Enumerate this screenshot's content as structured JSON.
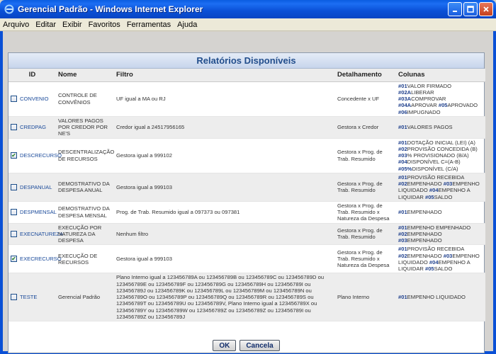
{
  "window": {
    "title": "Gerencial Padrão - Windows Internet Explorer"
  },
  "menu": [
    "Arquivo",
    "Editar",
    "Exibir",
    "Favoritos",
    "Ferramentas",
    "Ajuda"
  ],
  "panel": {
    "title": "Relatórios Disponíveis",
    "headers": {
      "id": "ID",
      "nome": "Nome",
      "filtro": "Filtro",
      "detalhamento": "Detalhamento",
      "colunas": "Colunas"
    },
    "ok_label": "OK",
    "cancel_label": "Cancela"
  },
  "rows": [
    {
      "id": "CONVENIO",
      "checked": false,
      "nome": "CONTROLE DE CONVÊNIOS",
      "filtro": "UF igual a MA ou RJ",
      "detalhamento": "Concedente x UF",
      "colunas": [
        [
          "#01",
          "VALOR FIRMADO "
        ],
        [
          "#02A",
          "LIBERAR "
        ],
        [
          "#03A",
          "COMPROVAR "
        ],
        [
          "#04A",
          "APROVAR "
        ],
        [
          "#05",
          "APROVADO "
        ],
        [
          "#06",
          "IMPUGNADO"
        ]
      ]
    },
    {
      "id": "CREDPAG",
      "checked": false,
      "nome": "VALORES PAGOS POR CREDOR POR NE'S",
      "filtro": "Credor igual a 24517956165",
      "detalhamento": "Gestora x Credor",
      "colunas": [
        [
          "#01",
          "VALORES PAGOS"
        ]
      ]
    },
    {
      "id": "DESCRECURSO",
      "checked": true,
      "nome": "DESCENTRALIZAÇÃO DE RECURSOS",
      "filtro": "Gestora igual a 999102",
      "detalhamento": "Gestora x Prog. de Trab. Resumido",
      "colunas": [
        [
          "#01",
          "DOTAÇÃO INICIAL (LEI) (A) "
        ],
        [
          "#02",
          "PROVISÃO CONCEDIDA (B) "
        ],
        [
          "#03",
          "% PROVISIONADO (B/A) "
        ],
        [
          "#04",
          "DISPONÍVEL C=(A-B) "
        ],
        [
          "#05%",
          "DISPONÍVEL (C/A)"
        ]
      ]
    },
    {
      "id": "DESPANUAL",
      "checked": false,
      "nome": "DEMOSTRATIVO DA DESPESA ANUAL",
      "filtro": "Gestora igual a 999103",
      "detalhamento": "Gestora x Prog. de Trab. Resumido",
      "colunas": [
        [
          "#01",
          "PROVISÃO RECEBIDA "
        ],
        [
          "#02",
          "EMPENHADO "
        ],
        [
          "#03",
          "EMPENHO LIQUIDADO "
        ],
        [
          "#04",
          "EMPENHO A LIQUIDAR "
        ],
        [
          "#05",
          "SALDO"
        ]
      ]
    },
    {
      "id": "DESPMENSAL",
      "checked": false,
      "nome": "DEMOSTRATIVO DA DESPESA MENSAL",
      "filtro": "Prog. de Trab. Resumido igual a 097373 ou 097381",
      "detalhamento": "Gestora x Prog. de Trab. Resumido x Natureza da Despesa",
      "colunas": [
        [
          "#01",
          "EMPENHADO"
        ]
      ]
    },
    {
      "id": "EXECNATUREZA",
      "checked": false,
      "nome": "EXECUÇÃO POR NATUREZA DA DESPESA",
      "filtro": "Nenhum filtro",
      "detalhamento": "Gestora x Prog. de Trab. Resumido",
      "colunas": [
        [
          "#01",
          "EMPENHO EMPENHADO "
        ],
        [
          "#02",
          "EMPENHADO "
        ],
        [
          "#03",
          "EMPENHADO"
        ]
      ]
    },
    {
      "id": "EXECRECURSO",
      "checked": true,
      "nome": "EXECUÇÃO DE RECURSOS",
      "filtro": "Gestora igual a 999103",
      "detalhamento": "Gestora x Prog. de Trab. Resumido x Natureza da Despesa",
      "colunas": [
        [
          "#01",
          "PROVISÃO RECEBIDA "
        ],
        [
          "#02",
          "EMPENHADO "
        ],
        [
          "#03",
          "EMPENHO LIQUIDADO "
        ],
        [
          "#04",
          "EMPENHO A LIQUIDAR "
        ],
        [
          "#05",
          "SALDO"
        ]
      ]
    },
    {
      "id": "TESTE",
      "checked": false,
      "nome": "Gerencial Padrão",
      "filtro": "Plano Interno igual a 123456789A ou 123456789B ou 123456789C ou 123456789D ou 123456789E ou 123456789F ou 123456789G ou 123456789H ou 123456789I ou 123456789J ou 123456789K ou 123456789L ou 123456789M ou 123456789N ou 123456789O ou 123456789P ou 123456789Q ou 123456789R ou 123456789S ou 123456789T ou 123456789U ou 123456789V, Plano Interno igual a 123456789X ou 123456789Y ou 123456789W ou 123456789Z ou 123456789Z ou 123456789I ou 123456789Z ou 123456789J",
      "detalhamento": "Plano Interno",
      "colunas": [
        [
          "#01",
          "EMPENHO LIQUIDADO"
        ]
      ]
    }
  ]
}
